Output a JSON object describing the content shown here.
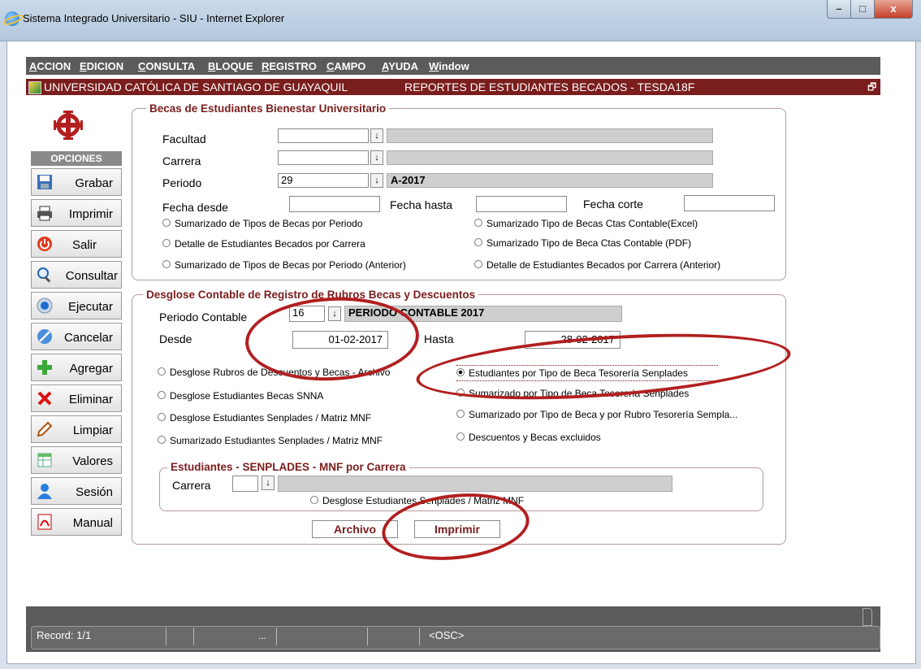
{
  "window": {
    "title": "Sistema Integrado Universitario - SIU - Internet Explorer",
    "min": "–",
    "max": "□",
    "close": "x"
  },
  "menu": [
    "ACCION",
    "EDICION",
    "CONSULTA",
    "BLOQUE",
    "REGISTRO",
    "CAMPO",
    "AYUDA",
    "Window"
  ],
  "header": {
    "university": "UNIVERSIDAD CATÓLICA DE SANTIAGO DE GUAYAQUIL",
    "report": "REPORTES DE ESTUDIANTES BECADOS - TESDA18F",
    "restore_icon": "restore-icon"
  },
  "sidebar": {
    "title": "OPCIONES",
    "buttons": [
      {
        "label": "Grabar",
        "icon": "save-icon"
      },
      {
        "label": "Imprimir",
        "icon": "printer-icon"
      },
      {
        "label": "Salir",
        "icon": "power-icon"
      },
      {
        "label": "Consultar",
        "icon": "magnifier-icon"
      },
      {
        "label": "Ejecutar",
        "icon": "execute-icon"
      },
      {
        "label": "Cancelar",
        "icon": "cancel-icon"
      },
      {
        "label": "Agregar",
        "icon": "plus-icon"
      },
      {
        "label": "Eliminar",
        "icon": "x-icon"
      },
      {
        "label": "Limpiar",
        "icon": "eraser-icon"
      },
      {
        "label": "Valores",
        "icon": "table-icon"
      },
      {
        "label": "Sesión",
        "icon": "user-icon"
      },
      {
        "label": "Manual",
        "icon": "pdf-icon"
      }
    ]
  },
  "becas": {
    "legend": "Becas de Estudiantes Bienestar Universitario",
    "facultad_label": "Facultad",
    "facultad_value": "",
    "facultad_desc": "",
    "carrera_label": "Carrera",
    "carrera_value": "",
    "carrera_desc": "",
    "periodo_label": "Periodo",
    "periodo_value": "29",
    "periodo_desc": "A-2017",
    "fecha_desde_label": "Fecha desde",
    "fecha_hasta_label": "Fecha hasta",
    "fecha_corte_label": "Fecha corte",
    "radios": [
      "Sumarizado de Tipos de Becas por Periodo",
      "Sumarizado Tipo de Becas Ctas Contable(Excel)",
      "Detalle de Estudiantes Becados por Carrera",
      "Sumarizado Tipo de Beca Ctas Contable (PDF)",
      "Sumarizado de Tipos de Becas por Periodo (Anterior)",
      "Detalle de Estudiantes Becados por Carrera (Anterior)"
    ]
  },
  "desglose": {
    "legend": "Desglose Contable de Registro de Rubros Becas y Descuentos",
    "periodo_label": "Periodo Contable",
    "periodo_value": "16",
    "periodo_desc": "PERIODO CONTABLE 2017",
    "desde_label": "Desde",
    "desde_value": "01-02-2017",
    "hasta_label": "Hasta",
    "hasta_value": "28-02-2017",
    "radios": [
      "Desglose Rubros de Descuentos y Becas - Archivo",
      "Estudiantes por Tipo de Beca Tesorería Senplades",
      "Desglose Estudiantes Becas SNNA",
      "Sumarizado por Tipo de Beca Tesorería Senplades",
      "Desglose Estudiantes Senplades / Matriz MNF",
      "Sumarizado por Tipo de Beca y por Rubro Tesorería Sempla...",
      "Sumarizado Estudiantes Senplades / Matriz MNF",
      "Descuentos y Becas excluidos"
    ],
    "selected_radio": 1,
    "sub_legend": "Estudiantes - SENPLADES - MNF por Carrera",
    "sub_carrera_label": "Carrera",
    "sub_carrera_value": "",
    "sub_radio": "Desglose Estudiantes Senplades / Matriz MNF",
    "archivo_button": "Archivo",
    "imprimir_button": "Imprimir"
  },
  "status": {
    "record": "Record: 1/1",
    "dots": "...",
    "osc": "<OSC>"
  },
  "colors": {
    "accent": "#7a1d1d",
    "highlight": "#b21f1f",
    "bar": "#5b5b5b"
  }
}
